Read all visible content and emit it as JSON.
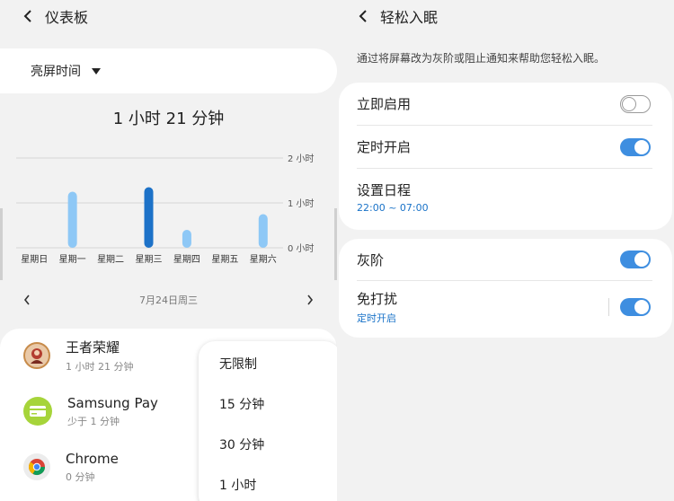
{
  "dashboard": {
    "title": "仪表板",
    "filter_label": "亮屏时间",
    "total_time": "1 小时 21 分钟",
    "date": "7月24日周三",
    "apps": [
      {
        "name": "王者荣耀",
        "usage": "1 小时 21 分钟",
        "icon": "game-icon"
      },
      {
        "name": "Samsung Pay",
        "usage": "少于 1 分钟",
        "icon": "card-icon"
      },
      {
        "name": "Chrome",
        "usage": "0 分钟",
        "icon": "chrome-icon"
      }
    ],
    "timer_options": [
      "无限制",
      "15 分钟",
      "30 分钟",
      "1 小时"
    ]
  },
  "chart_data": {
    "type": "bar",
    "categories": [
      "星期日",
      "星期一",
      "星期二",
      "星期三",
      "星期四",
      "星期五",
      "星期六"
    ],
    "values": [
      0,
      1.25,
      0,
      1.35,
      0.4,
      0,
      0.75
    ],
    "highlight_index": 3,
    "ylim": [
      0,
      2
    ],
    "y_ticks": [
      {
        "value": 2,
        "label": "2 小时"
      },
      {
        "value": 1,
        "label": "1 小时"
      },
      {
        "value": 0,
        "label": "0 小时"
      }
    ],
    "grid": true,
    "colors": {
      "bar": "#8ec8f6",
      "highlight": "#1d72c8",
      "grid": "#d6d6d6"
    }
  },
  "sleep": {
    "title": "轻松入眠",
    "description": "通过将屏幕改为灰阶或阻止通知来帮助您轻松入眠。",
    "rows": [
      {
        "label": "立即启用",
        "on": false
      },
      {
        "label": "定时开启",
        "on": true
      },
      {
        "label": "设置日程",
        "sub": "22:00 ~ 07:00"
      }
    ],
    "rows2": [
      {
        "label": "灰阶",
        "on": true
      },
      {
        "label": "免打扰",
        "sub": "定时开启",
        "on": true
      }
    ]
  },
  "colors": {
    "accent": "#3e8ee0",
    "sub_text_blue": "#1a73c8"
  }
}
